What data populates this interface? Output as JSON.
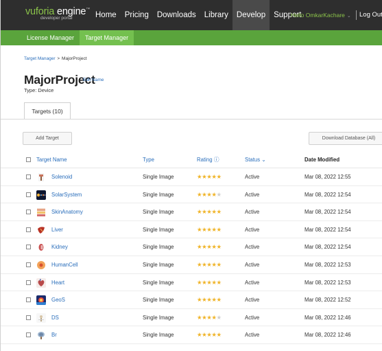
{
  "header": {
    "logo": {
      "brand_first": "vuforia",
      "brand_second": " engine",
      "brand_mark": "™",
      "subtitle": "developer portal"
    },
    "nav": [
      {
        "label": "Home",
        "active": false
      },
      {
        "label": "Pricing",
        "active": false
      },
      {
        "label": "Downloads",
        "active": false
      },
      {
        "label": "Library",
        "active": false
      },
      {
        "label": "Develop",
        "active": true
      },
      {
        "label": "Support",
        "active": false
      }
    ],
    "user_greeting": "Hello OmkarKachare",
    "logout_label": "Log Out"
  },
  "subnav": [
    {
      "label": "License Manager",
      "active": false
    },
    {
      "label": "Target Manager",
      "active": true
    }
  ],
  "breadcrumb": {
    "parent": "Target Manager",
    "separator": ">",
    "current": "MajorProject"
  },
  "project": {
    "title": "MajorProject",
    "edit_label": "Edit Name",
    "type_line": "Type: Device"
  },
  "tabs": [
    {
      "label": "Targets (10)"
    }
  ],
  "toolbar": {
    "add_label": "Add Target",
    "download_label": "Download Database (All)"
  },
  "table": {
    "headers": {
      "name": "Target Name",
      "type": "Type",
      "rating": "Rating ⓘ",
      "status": "Status ⌄",
      "date": "Date Modified"
    },
    "rows": [
      {
        "name": "Solenoid",
        "type": "Single Image",
        "rating": 5,
        "status": "Active",
        "date": "Mar 08, 2022 12:55",
        "thumb": "solenoid"
      },
      {
        "name": "SolarSystem",
        "type": "Single Image",
        "rating": 4,
        "status": "Active",
        "date": "Mar 08, 2022 12:54",
        "thumb": "solarsystem"
      },
      {
        "name": "SkinAnatomy",
        "type": "Single Image",
        "rating": 5,
        "status": "Active",
        "date": "Mar 08, 2022 12:54",
        "thumb": "skinanatomy"
      },
      {
        "name": "Liver",
        "type": "Single Image",
        "rating": 5,
        "status": "Active",
        "date": "Mar 08, 2022 12:54",
        "thumb": "liver"
      },
      {
        "name": "Kidney",
        "type": "Single Image",
        "rating": 5,
        "status": "Active",
        "date": "Mar 08, 2022 12:54",
        "thumb": "kidney"
      },
      {
        "name": "HumanCell",
        "type": "Single Image",
        "rating": 5,
        "status": "Active",
        "date": "Mar 08, 2022 12:53",
        "thumb": "humancell"
      },
      {
        "name": "Heart",
        "type": "Single Image",
        "rating": 5,
        "status": "Active",
        "date": "Mar 08, 2022 12:53",
        "thumb": "heart"
      },
      {
        "name": "GeoS",
        "type": "Single Image",
        "rating": 5,
        "status": "Active",
        "date": "Mar 08, 2022 12:52",
        "thumb": "geos"
      },
      {
        "name": "DS",
        "type": "Single Image",
        "rating": 4,
        "status": "Active",
        "date": "Mar 08, 2022 12:46",
        "thumb": "ds"
      },
      {
        "name": "Br",
        "type": "Single Image",
        "rating": 5,
        "status": "Active",
        "date": "Mar 08, 2022 12:46",
        "thumb": "br"
      }
    ],
    "max_rating": 5
  },
  "colors": {
    "topbar": "#2e2e2e",
    "subbar": "#5aa43c",
    "subbar_active": "#74c04f",
    "link": "#2a6ebb",
    "star": "#f0b429"
  }
}
